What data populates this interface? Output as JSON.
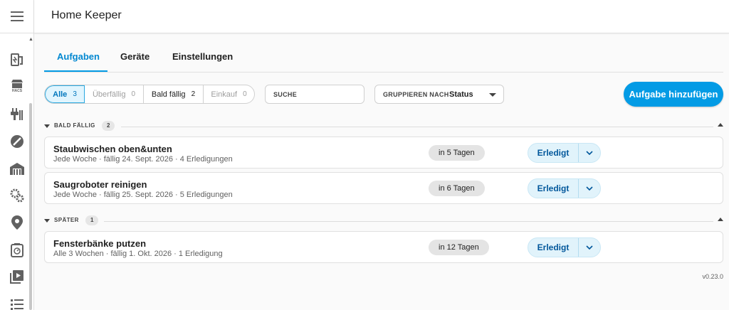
{
  "app": {
    "title": "Home Keeper",
    "version": "v0.23.0"
  },
  "sidebar": {
    "items": [
      {
        "name": "energy-icon"
      },
      {
        "name": "hacs-icon",
        "label": "HACS"
      },
      {
        "name": "plug-icon"
      },
      {
        "name": "compass-icon"
      },
      {
        "name": "warehouse-icon"
      },
      {
        "name": "gears-icon"
      },
      {
        "name": "map-marker-icon"
      },
      {
        "name": "timer-icon"
      },
      {
        "name": "media-icon"
      },
      {
        "name": "list-icon"
      }
    ]
  },
  "tabs": [
    {
      "label": "Aufgaben",
      "active": true
    },
    {
      "label": "Geräte"
    },
    {
      "label": "Einstellungen"
    }
  ],
  "filters": [
    {
      "label": "Alle",
      "count": "3"
    },
    {
      "label": "Überfällig",
      "count": "0"
    },
    {
      "label": "Bald fällig",
      "count": "2"
    },
    {
      "label": "Einkauf",
      "count": "0"
    }
  ],
  "search": {
    "label": "SUCHE"
  },
  "group_by": {
    "label": "GRUPPIEREN NACH",
    "value": "Status"
  },
  "add_button": "Aufgabe hinzufügen",
  "groups": [
    {
      "title": "BALD FÄLLIG",
      "count": "2",
      "tasks": [
        {
          "name": "Staubwischen oben&unten",
          "meta": "Jede Woche · fällig 24. Sept. 2026 · 4 Erledigungen",
          "due": "in 5 Tagen",
          "action": "Erledigt"
        },
        {
          "name": "Saugroboter reinigen",
          "meta": "Jede Woche · fällig 25. Sept. 2026 · 5 Erledigungen",
          "due": "in 6 Tagen",
          "action": "Erledigt"
        }
      ]
    },
    {
      "title": "SPÄTER",
      "count": "1",
      "tasks": [
        {
          "name": "Fensterbänke putzen",
          "meta": "Alle 3 Wochen · fällig 1. Okt. 2026 · 1 Erledigung",
          "due": "in 12 Tagen",
          "action": "Erledigt"
        }
      ]
    }
  ],
  "colors": {
    "accent": "#039be5",
    "done_bg": "#e1f3fb",
    "due_bg": "#e4e4e4"
  }
}
